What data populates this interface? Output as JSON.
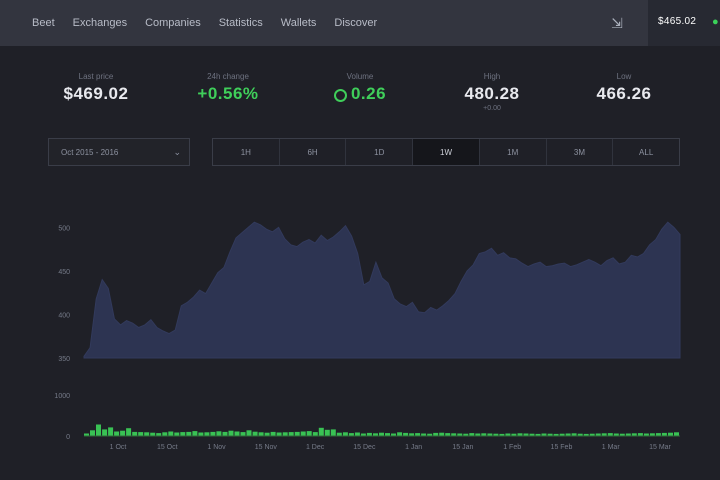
{
  "nav": {
    "items": [
      "Beet",
      "Exchanges",
      "Companies",
      "Statistics",
      "Wallets",
      "Discover"
    ],
    "export_icon": "export-icon",
    "account": "$465.02"
  },
  "stats": [
    {
      "label": "Last price",
      "value": "$469.02",
      "color": "white"
    },
    {
      "label": "24h change",
      "value": "+0.56%",
      "color": "green"
    },
    {
      "label": "Volume",
      "value": "0.26",
      "color": "green",
      "icon": "coin-icon"
    },
    {
      "label": "High",
      "value": "480.28",
      "sub": "+0.00",
      "color": "white"
    },
    {
      "label": "Low",
      "value": "466.26",
      "color": "white"
    }
  ],
  "controls": {
    "range": "Oct 2015 - 2016",
    "intervals": [
      "1H",
      "6H",
      "1D",
      "1W",
      "1M",
      "3M",
      "ALL"
    ],
    "active_interval": 3
  },
  "colors": {
    "area_fill": "#2d3452",
    "area_stroke": "#323a5c",
    "volume": "#39c254",
    "background": "#1f2027"
  },
  "chart_data": {
    "type": "area",
    "y_ticks": [
      "500",
      "450",
      "400",
      "350"
    ],
    "ylim": [
      350,
      520
    ],
    "volume_ticks": [
      "1000",
      "0"
    ],
    "volume_lim": [
      0,
      1000
    ],
    "x_ticks": [
      "1 Oct",
      "15 Oct",
      "1 Nov",
      "15 Nov",
      "1 Dec",
      "15 Dec",
      "1 Jan",
      "15 Jan",
      "1 Feb",
      "15 Feb",
      "1 Mar",
      "15 Mar"
    ],
    "price": [
      352,
      362,
      418,
      440,
      430,
      395,
      388,
      393,
      390,
      385,
      388,
      394,
      385,
      381,
      378,
      382,
      410,
      414,
      420,
      428,
      424,
      436,
      448,
      454,
      472,
      488,
      494,
      500,
      506,
      503,
      498,
      495,
      500,
      487,
      480,
      478,
      483,
      486,
      482,
      491,
      485,
      489,
      495,
      502,
      490,
      470,
      434,
      438,
      460,
      442,
      436,
      418,
      412,
      409,
      414,
      403,
      402,
      408,
      405,
      410,
      416,
      424,
      438,
      450,
      457,
      470,
      472,
      476,
      468,
      471,
      465,
      464,
      459,
      455,
      458,
      460,
      455,
      456,
      458,
      459,
      455,
      457,
      460,
      463,
      460,
      456,
      462,
      465,
      458,
      460,
      468,
      466,
      470,
      480,
      486,
      498,
      506,
      500,
      492
    ],
    "volume": [
      60,
      140,
      280,
      160,
      210,
      110,
      130,
      190,
      100,
      95,
      90,
      80,
      70,
      90,
      110,
      85,
      95,
      100,
      120,
      85,
      90,
      100,
      115,
      100,
      130,
      110,
      95,
      140,
      105,
      90,
      80,
      100,
      85,
      90,
      95,
      100,
      110,
      120,
      95,
      200,
      150,
      160,
      80,
      90,
      70,
      85,
      60,
      75,
      65,
      80,
      70,
      60,
      90,
      75,
      65,
      70,
      60,
      55,
      75,
      80,
      70,
      65,
      60,
      55,
      70,
      60,
      65,
      60,
      55,
      50,
      60,
      55,
      65,
      60,
      55,
      50,
      60,
      55,
      50,
      55,
      60,
      65,
      55,
      50,
      55,
      60,
      65,
      70,
      60,
      55,
      60,
      65,
      70,
      60,
      65,
      70,
      75,
      80,
      90
    ]
  }
}
